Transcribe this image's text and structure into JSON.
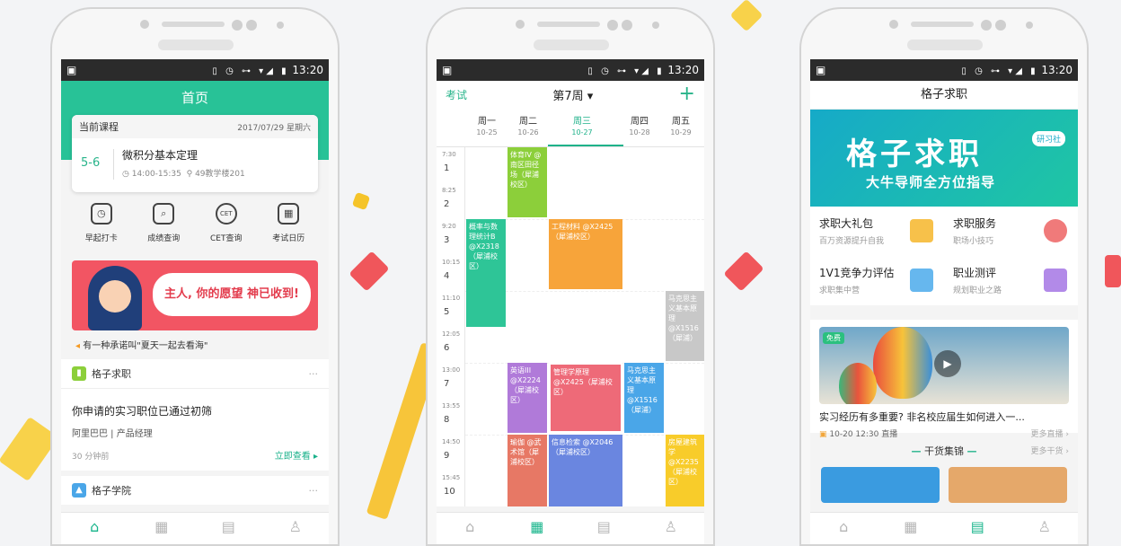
{
  "status": {
    "time": "13:20",
    "icons": "▯ ◷ ⊶ ▾◢ ▮"
  },
  "phone1": {
    "title": "首页",
    "course_card": {
      "label": "当前课程",
      "date": "2017/07/29 星期六",
      "section": "5-6",
      "name": "微积分基本定理",
      "time": "14:00-15:35",
      "room": "49教学楼201"
    },
    "shortcuts": [
      {
        "label": "早起打卡",
        "icon": "alarm-clock-icon",
        "glyph": "◷"
      },
      {
        "label": "成绩查询",
        "icon": "grade-search-icon",
        "glyph": "⌕"
      },
      {
        "label": "CET查询",
        "icon": "cet-icon",
        "glyph": "CET"
      },
      {
        "label": "考试日历",
        "icon": "calendar-icon",
        "glyph": "▦"
      }
    ],
    "banner_text": "主人, 你的愿望 神已收到!",
    "promise": "有一种承诺叫\"夏天一起去看海\"",
    "section_job": "格子求职",
    "job": {
      "title": "你申请的实习职位已通过初筛",
      "company": "阿里巴巴 | 产品经理",
      "time": "30 分钟前",
      "action": "立即查看 ▸"
    },
    "section_academy": "格子学院"
  },
  "phone2": {
    "left": "考试",
    "week": "第7周 ▾",
    "add": "+",
    "days": [
      {
        "name": "周一",
        "date": "10-25"
      },
      {
        "name": "周二",
        "date": "10-26"
      },
      {
        "name": "周三",
        "date": "10-27"
      },
      {
        "name": "周四",
        "date": "10-28"
      },
      {
        "name": "周五",
        "date": "10-29"
      }
    ],
    "times": [
      "7:30",
      "8:25",
      "9:20",
      "10:15",
      "11:10",
      "12:05",
      "13:00",
      "13:55",
      "14:50",
      "15:45"
    ],
    "periods": [
      "1",
      "2",
      "3",
      "4",
      "5",
      "6",
      "7",
      "8",
      "9",
      "10"
    ],
    "blocks": [
      {
        "text": "概率与数理统计B @X2318（犀浦校区）",
        "color": "#2ec597"
      },
      {
        "text": "体育IV @南区田径场（犀浦校区）",
        "color": "#8ccf3a"
      },
      {
        "text": "工程材料 @X2425（犀浦校区）",
        "color": "#f7a43a"
      },
      {
        "text": "马克思主义基本原理 @X1516（犀浦）",
        "color": "#c8c8c8"
      },
      {
        "text": "英语III @X2224（犀浦校区）",
        "color": "#b07ad9"
      },
      {
        "text": "管理学原理 @X2425（犀浦校区）",
        "color": "#ee6a78"
      },
      {
        "text": "马克思主义基本原理 @X1516（犀浦）",
        "color": "#4aa6e8"
      },
      {
        "text": "瑜伽 @武术馆（犀浦校区）",
        "color": "#e77865"
      },
      {
        "text": "信息检索 @X2046（犀浦校区）",
        "color": "#6a86e0"
      },
      {
        "text": "房屋建筑学 @X2235（犀浦校区）",
        "color": "#f8cc2a"
      }
    ]
  },
  "phone3": {
    "title": "格子求职",
    "banner": {
      "title": "格子求职",
      "badge": "研习社",
      "sub": "大牛导师全方位指导"
    },
    "services": [
      {
        "name": "求职大礼包",
        "desc": "百万资源提升自我",
        "color": "#f7c14a"
      },
      {
        "name": "求职服务",
        "desc": "职场小技巧",
        "color": "#f07a7a"
      },
      {
        "name": "1V1竞争力评估",
        "desc": "求职集中营",
        "color": "#66b7ee"
      },
      {
        "name": "职业测评",
        "desc": "规划职业之路",
        "color": "#b28ae8"
      }
    ],
    "video": {
      "badge": "免费",
      "title": "实习经历有多重要? 非名校应届生如何进入一...",
      "meta": "10-20 12:30 直播",
      "more": "更多直播 ›"
    },
    "dry": {
      "title": "干货集锦",
      "more": "更多干货 ›"
    }
  }
}
